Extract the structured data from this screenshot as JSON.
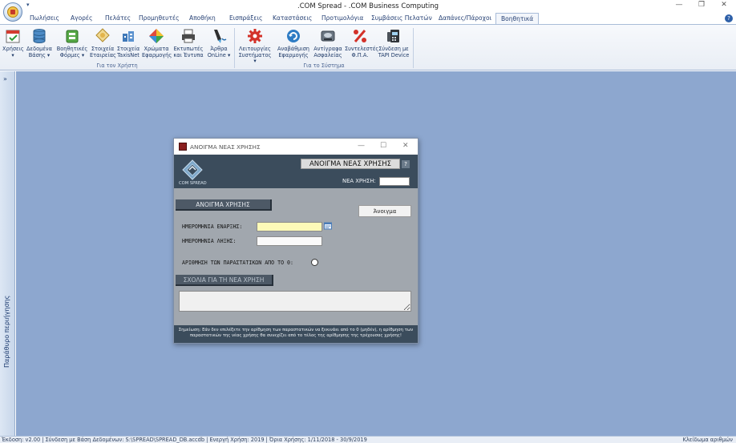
{
  "window": {
    "title": ".COM Spread - .COM Business Computing",
    "quick_access_glyph": "▾",
    "minimize_glyph": "—",
    "restore_glyph": "❐",
    "close_glyph": "✕"
  },
  "tabs": [
    {
      "label": "Πωλήσεις"
    },
    {
      "label": "Αγορές"
    },
    {
      "label": "Πελάτες"
    },
    {
      "label": "Προμηθευτές"
    },
    {
      "label": "Αποθήκη"
    },
    {
      "label": "Εισπράξεις"
    },
    {
      "label": "Καταστάσεις"
    },
    {
      "label": "Προτιμολόγια"
    },
    {
      "label": "Συμβάσεις Πελατών"
    },
    {
      "label": "Δαπάνες/Πάροχοι"
    },
    {
      "label": "Βοηθητικά"
    }
  ],
  "active_tab": "Βοηθητικά",
  "help_glyph": "?",
  "ribbon": {
    "groups": [
      {
        "label": "Για τον Χρήστη",
        "buttons": [
          {
            "line1": "Χρήσεις",
            "line2": "▾",
            "icon": "calendar-icon"
          },
          {
            "line1": "Δεδομένα",
            "line2": "Βάσης ▾",
            "icon": "database-icon"
          },
          {
            "line1": "Βοηθητικές",
            "line2": "Φόρμες ▾",
            "icon": "forms-icon"
          },
          {
            "line1": "Στοιχεία",
            "line2": "Εταιρείας",
            "icon": "company-icon"
          },
          {
            "line1": "Στοιχεία",
            "line2": "TaxisNet",
            "icon": "taxisnet-icon"
          },
          {
            "line1": "Χρώματα",
            "line2": "Εφαρμογής",
            "icon": "palette-icon"
          },
          {
            "line1": "Εκτυπωτές",
            "line2": "και Έντυπα",
            "icon": "printer-icon"
          },
          {
            "line1": "Άρθρα",
            "line2": "OnLine ▾",
            "icon": "articles-icon"
          }
        ]
      },
      {
        "label": "Για το Σύστημα",
        "buttons": [
          {
            "line1": "Λειτουργίες",
            "line2": "Συστήματος ▾",
            "icon": "system-gear-icon"
          },
          {
            "line1": "Αναβάθμιση",
            "line2": "Εφαρμογής",
            "icon": "update-icon"
          },
          {
            "line1": "Αντίγραφα",
            "line2": "Ασφαλείας",
            "icon": "backup-icon"
          },
          {
            "line1": "Συντελεστές",
            "line2": "Φ.Π.Α.",
            "icon": "percent-icon"
          },
          {
            "line1": "Σύνδεση με",
            "line2": "TAPI Device",
            "icon": "tapi-phone-icon"
          }
        ]
      }
    ]
  },
  "nav_pane": {
    "label": "Παράθυρο περιήγησης",
    "chevron": "»"
  },
  "dialog": {
    "title": "ΑΝΟΙΓΜΑ ΝΕΑΣ ΧΡΗΣΗΣ",
    "minimize_glyph": "—",
    "maximize_glyph": "☐",
    "close_glyph": "✕",
    "logo_text": "COM SPREAD",
    "heading": "ΑΝΟΙΓΜΑ ΝΕΑΣ ΧΡΗΣΗΣ",
    "help_glyph": "?",
    "new_year_label": "ΝΕΑ ΧΡΗΣΗ:",
    "new_year_value": "",
    "open_year_button": "ΑΝΟΙΓΜΑ ΧΡΗΣΗΣ",
    "open_button": "Άνοιγμα",
    "start_date_label": "ΗΜΕΡΟΜΗΝΙΑ ΕΝΑΡΞΗΣ:",
    "start_date_value": "",
    "end_date_label": "ΗΜΕΡΟΜΗΝΙΑ ΛΗΞΗΣ:",
    "end_date_value": "",
    "numbering_label": "ΑΡΙΘΜΗΣΗ ΤΩΝ ΠΑΡΑΣΤΑΤΙΚΩΝ ΑΠΟ ΤΟ 0:",
    "numbering_checked": false,
    "comments_header": "ΣΧΟΛΙΑ ΓΙΑ ΤΗ ΝΕΑ ΧΡΗΣΗ",
    "comments_value": "",
    "note": "Σημείωση: Εάν δεν επιλέξετε την αρίθμηση των παραστατικών να ξεκινάει από το 0 (μηδέν), η αρίθμηση των παραστατικών της νέας χρήσης θα συνεχίζει από το τέλος της αρίθμησης της τρέχουσας χρήσης!"
  },
  "status_bar": {
    "text": "Έκδοση: v2.00  |  Σύνδεση με Βάση Δεδομένων: S:\\SPREAD\\SPREAD_DB.accdb  |  Ενεργή Χρήση: 2019  |  Όρια Χρήσης: 1/11/2018 - 30/9/2019",
    "right_text": "Κλείδωμα αριθμών"
  },
  "colors": {
    "workspace": "#8da7cf",
    "dialog_header": "#3b4c5c",
    "dialog_body": "#a1a7ae",
    "start_date_field": "#fdfab8"
  }
}
